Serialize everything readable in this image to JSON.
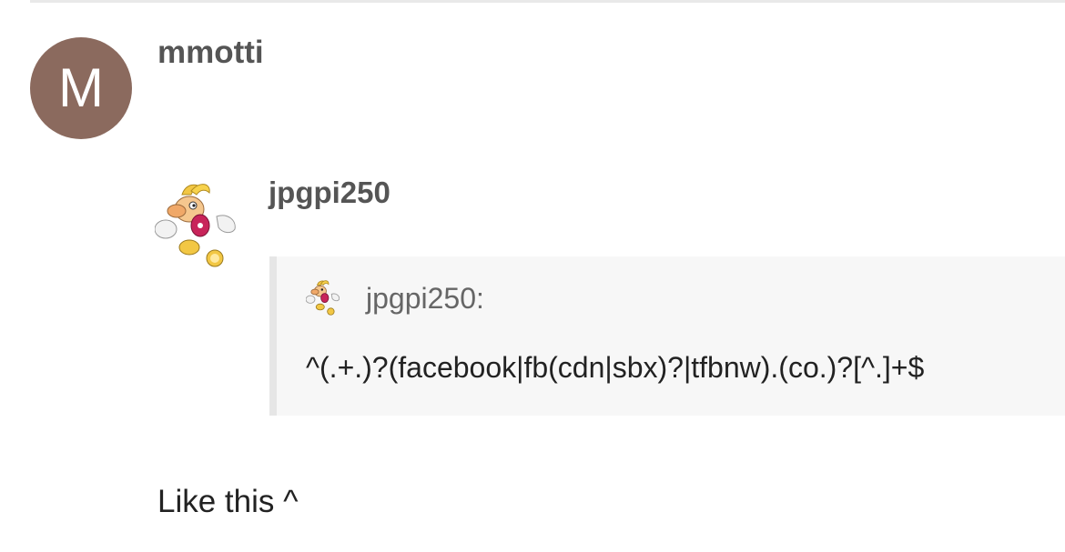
{
  "post": {
    "avatar_letter": "M",
    "avatar_color": "#8b6a5e",
    "username": "mmotti"
  },
  "quote": {
    "author": "jpgpi250",
    "avatar_icon": "cartoon-character-avatar-icon",
    "inner_author": "jpgpi250:",
    "text": "^(.+.)?(facebook|fb(cdn|sbx)?|tfbnw).(co.)?[^.]+$"
  },
  "reply": {
    "text": "Like this ^"
  }
}
